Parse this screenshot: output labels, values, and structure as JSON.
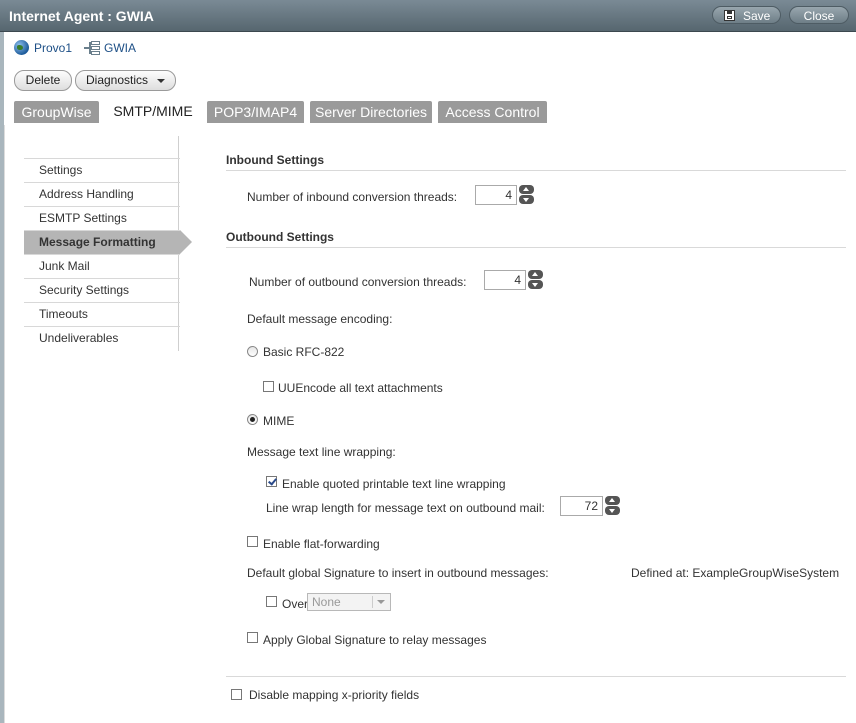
{
  "window": {
    "title": "Internet Agent : GWIA",
    "save_label": "Save",
    "close_label": "Close"
  },
  "breadcrumb": {
    "domain": "Provo1",
    "agent": "GWIA"
  },
  "actions": {
    "delete_label": "Delete",
    "diagnostics_label": "Diagnostics"
  },
  "tabs": [
    {
      "label": "GroupWise"
    },
    {
      "label": "SMTP/MIME"
    },
    {
      "label": "POP3/IMAP4"
    },
    {
      "label": "Server Directories"
    },
    {
      "label": "Access Control"
    }
  ],
  "active_tab": "SMTP/MIME",
  "sidebar": {
    "items": [
      {
        "label": "Settings"
      },
      {
        "label": "Address Handling"
      },
      {
        "label": "ESMTP Settings"
      },
      {
        "label": "Message Formatting"
      },
      {
        "label": "Junk Mail"
      },
      {
        "label": "Security Settings"
      },
      {
        "label": "Timeouts"
      },
      {
        "label": "Undeliverables"
      }
    ],
    "active": "Message Formatting"
  },
  "inbound": {
    "heading": "Inbound Settings",
    "threads_label": "Number of inbound conversion threads:",
    "threads_value": "4"
  },
  "outbound": {
    "heading": "Outbound Settings",
    "threads_label": "Number of outbound conversion threads:",
    "threads_value": "4",
    "encoding_label": "Default message encoding:",
    "basic_rfc_label": "Basic RFC-822",
    "basic_rfc_selected": false,
    "uuencode_label": "UUEncode all text attachments",
    "uuencode_checked": false,
    "mime_label": "MIME",
    "mime_selected": true,
    "wrapping_label": "Message text line wrapping:",
    "quoted_printable_label": "Enable quoted printable text line wrapping",
    "quoted_printable_checked": true,
    "line_wrap_label": "Line wrap length for message text on outbound mail:",
    "line_wrap_value": "72",
    "flat_forward_label": "Enable flat-forwarding",
    "flat_forward_checked": false,
    "signature_label": "Default global Signature to insert in outbound messages:",
    "defined_at_label": "Defined at: ExampleGroupWiseSystem",
    "override_label": "Override",
    "override_checked": false,
    "signature_select": "None",
    "relay_label": "Apply Global Signature to relay messages",
    "relay_checked": false
  },
  "xpriority": {
    "label": "Disable mapping x-priority fields",
    "checked": false
  },
  "colors": {
    "titlebar": "#5f6f79",
    "tab_inactive": "#9a9a9a",
    "nav_active": "#b5b5b5",
    "link": "#1d4f86"
  }
}
